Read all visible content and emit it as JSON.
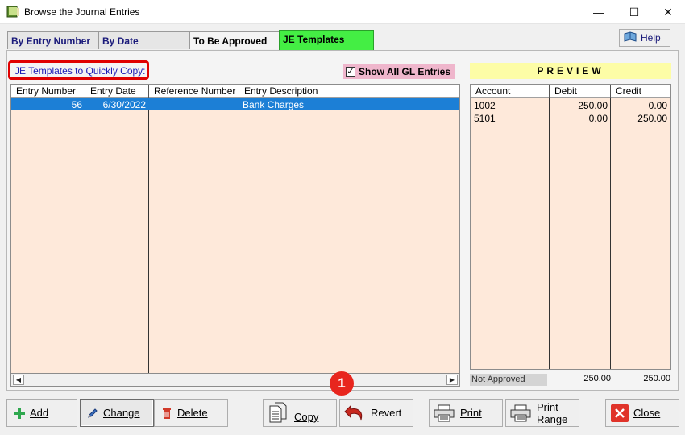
{
  "window": {
    "title": "Browse the Journal Entries",
    "minimize": "—",
    "maximize": "☐",
    "close": "✕"
  },
  "tabs": [
    {
      "label": "By Entry Number",
      "active": false
    },
    {
      "label": "By Date",
      "active": false
    },
    {
      "label": "To Be Approved",
      "active": false
    },
    {
      "label": "JE Templates",
      "active": true,
      "color": "#44ee44"
    }
  ],
  "help_label": "Help",
  "templates_label": "JE Templates to Quickly Copy:",
  "show_all": {
    "label": "Show All GL Entries",
    "checked": true
  },
  "grid": {
    "columns": [
      "Entry Number",
      "Entry Date",
      "Reference Number",
      "Entry Description"
    ],
    "rows": [
      {
        "entry_number": "56",
        "entry_date": "6/30/2022",
        "reference_number": "",
        "description": "Bank Charges",
        "selected": true
      }
    ]
  },
  "preview": {
    "title": "PREVIEW",
    "columns": [
      "Account",
      "Debit",
      "Credit"
    ],
    "rows": [
      {
        "account": "1002",
        "debit": "250.00",
        "credit": "0.00"
      },
      {
        "account": "5101",
        "debit": "0.00",
        "credit": "250.00"
      }
    ],
    "status": "Not Approved",
    "total_debit": "250.00",
    "total_credit": "250.00"
  },
  "buttons": {
    "add": "Add",
    "change": "Change",
    "delete": "Delete",
    "copy": "Copy",
    "revert": "Revert",
    "print": "Print",
    "print_range_1": "Print",
    "print_range_2": "Range",
    "close": "Close"
  },
  "callout": "1",
  "colors": {
    "selection": "#1c7fd6",
    "grid_bg": "#fee9da",
    "preview_title_bg": "#fdfda6",
    "active_tab": "#44ee44",
    "highlight_border": "#e00000",
    "callout": "#e8261e"
  }
}
